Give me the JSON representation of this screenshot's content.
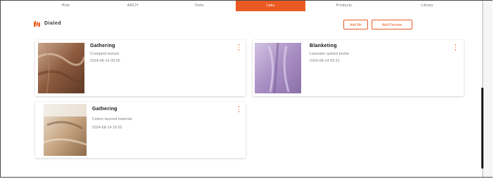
{
  "tabs": [
    {
      "label": "Hole"
    },
    {
      "label": "ARCH"
    },
    {
      "label": "Tools"
    },
    {
      "label": "Labs"
    },
    {
      "label": "Products"
    },
    {
      "label": "Library"
    }
  ],
  "active_tab_index": 3,
  "brand": {
    "title": "Dialed",
    "icon": "flame-logo-icon"
  },
  "actions": {
    "primary": "Add file",
    "secondary": "Add Preview"
  },
  "cards": [
    {
      "title": "Gathering",
      "line1": "Crumpled texture",
      "line2": "2024-08-14 09:25",
      "image": "brown-fabric"
    },
    {
      "title": "Blanketing",
      "line1": "Lavender quilted textile",
      "line2": "2024-08-14 09:31",
      "image": "purple-fabric"
    },
    {
      "title": "Gathering",
      "line1": "Cotton layered material",
      "line2": "2024-08-14 10:02",
      "image": "beige-fabric"
    }
  ],
  "colors": {
    "accent": "#ea5a22"
  }
}
